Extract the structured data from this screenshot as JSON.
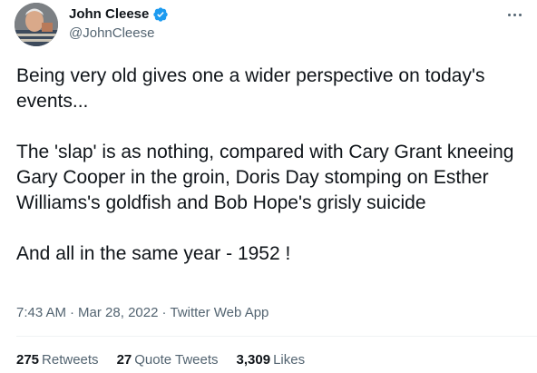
{
  "author": {
    "display_name": "John Cleese",
    "handle": "@JohnCleese",
    "verified": true,
    "avatar_icon": "profile-photo",
    "verified_icon": "verified-badge-icon"
  },
  "menu": {
    "more_icon": "more-horizontal-icon"
  },
  "tweet": {
    "paragraphs": [
      "Being very old gives one a wider perspective on today's events...",
      "The 'slap' is as nothing, compared with Cary Grant kneeing Gary Cooper in the groin, Doris Day stomping on Esther Williams's goldfish and Bob Hope's grisly suicide",
      "And all in the same year - 1952 !"
    ]
  },
  "meta": {
    "time": "7:43 AM",
    "date": "Mar 28, 2022",
    "source": "Twitter Web App",
    "separator": "·"
  },
  "stats": [
    {
      "count": "275",
      "label": "Retweets"
    },
    {
      "count": "27",
      "label": "Quote Tweets"
    },
    {
      "count": "3,309",
      "label": "Likes"
    }
  ],
  "colors": {
    "text_primary": "#0f1419",
    "text_secondary": "#536471",
    "verified_blue": "#1d9bf0",
    "divider": "#eff3f4"
  }
}
